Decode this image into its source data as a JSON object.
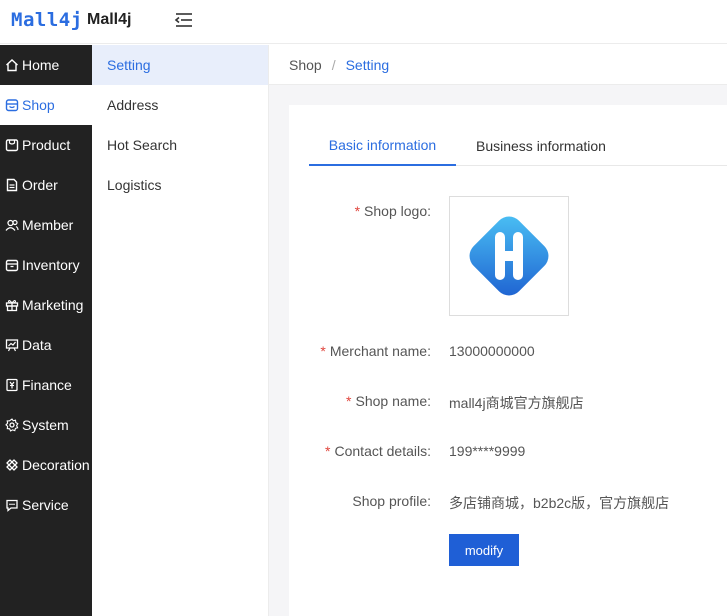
{
  "header": {
    "logo_text": "Mall4j",
    "brand": "Mall4j",
    "fold_icon": "menu-fold-icon"
  },
  "sidebar": {
    "items": [
      {
        "label": "Home",
        "icon": "home-icon"
      },
      {
        "label": "Shop",
        "icon": "shop-icon",
        "active": true
      },
      {
        "label": "Product",
        "icon": "product-icon"
      },
      {
        "label": "Order",
        "icon": "order-icon"
      },
      {
        "label": "Member",
        "icon": "member-icon"
      },
      {
        "label": "Inventory",
        "icon": "inventory-icon"
      },
      {
        "label": "Marketing",
        "icon": "gift-icon"
      },
      {
        "label": "Data",
        "icon": "chart-icon"
      },
      {
        "label": "Finance",
        "icon": "yen-icon"
      },
      {
        "label": "System",
        "icon": "gear-icon"
      },
      {
        "label": "Decoration",
        "icon": "decoration-icon"
      },
      {
        "label": "Service",
        "icon": "chat-icon"
      }
    ]
  },
  "submenu": {
    "items": [
      {
        "label": "Setting",
        "active": true
      },
      {
        "label": "Address"
      },
      {
        "label": "Hot Search"
      },
      {
        "label": "Logistics"
      }
    ]
  },
  "breadcrumb": {
    "parent": "Shop",
    "separator": "/",
    "current": "Setting"
  },
  "tabs": [
    {
      "label": "Basic information",
      "active": true
    },
    {
      "label": "Business information"
    }
  ],
  "form": {
    "shop_logo_label": "Shop logo:",
    "merchant_name_label": "Merchant name:",
    "merchant_name_value": "13000000000",
    "shop_name_label": "Shop name:",
    "shop_name_value": "mall4j商城官方旗舰店",
    "contact_label": "Contact details:",
    "contact_value": "199****9999",
    "profile_label": "Shop profile:",
    "profile_value": "多店铺商城，b2b2c版，官方旗舰店",
    "required_mark": "*",
    "modify_label": "modify"
  },
  "colors": {
    "accent": "#2b6de0",
    "sidebar_bg": "#222222",
    "button_bg": "#1f5fd6",
    "required": "#e0443c"
  }
}
